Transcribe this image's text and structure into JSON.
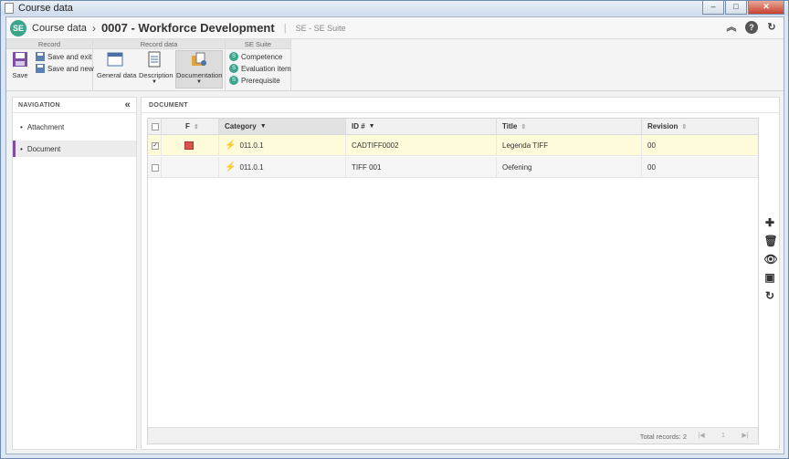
{
  "window": {
    "title": "Course data",
    "buttons": [
      "–",
      "□",
      "✕"
    ]
  },
  "header": {
    "breadcrumb": "Course data",
    "record_title": "0007 - Workforce Development",
    "suite": "SE - SE Suite",
    "logo": "SE"
  },
  "ribbon": {
    "groups": {
      "record": "Record",
      "record_data": "Record data",
      "se_suite": "SE Suite"
    },
    "save": "Save",
    "save_and_exit": "Save and exit",
    "save_and_new": "Save and new",
    "general_data": "General data",
    "description": "Description",
    "documentation": "Documentation",
    "competence": "Competence",
    "evaluation_item": "Evaluation item",
    "prerequisite": "Prerequisite"
  },
  "navigation": {
    "title": "NAVIGATION",
    "items": [
      {
        "label": "Attachment",
        "active": false
      },
      {
        "label": "Document",
        "active": true
      }
    ]
  },
  "document": {
    "title": "DOCUMENT",
    "columns": {
      "f": "F",
      "category": "Category",
      "id": "ID #",
      "title": "Title",
      "revision": "Revision"
    },
    "rows": [
      {
        "checked": true,
        "category": "011.0.1",
        "id": "CADTIFF0002",
        "title": "Legenda TIFF",
        "revision": "00"
      },
      {
        "checked": false,
        "category": "011.0.1",
        "id": "TIFF 001",
        "title": "Oefening",
        "revision": "00"
      }
    ],
    "footer": {
      "total": "Total records: 2",
      "page": "1"
    }
  },
  "colors": {
    "accent": "#7c4fa5",
    "brand": "#3aa58a",
    "selected_row": "#fdfbd9"
  }
}
